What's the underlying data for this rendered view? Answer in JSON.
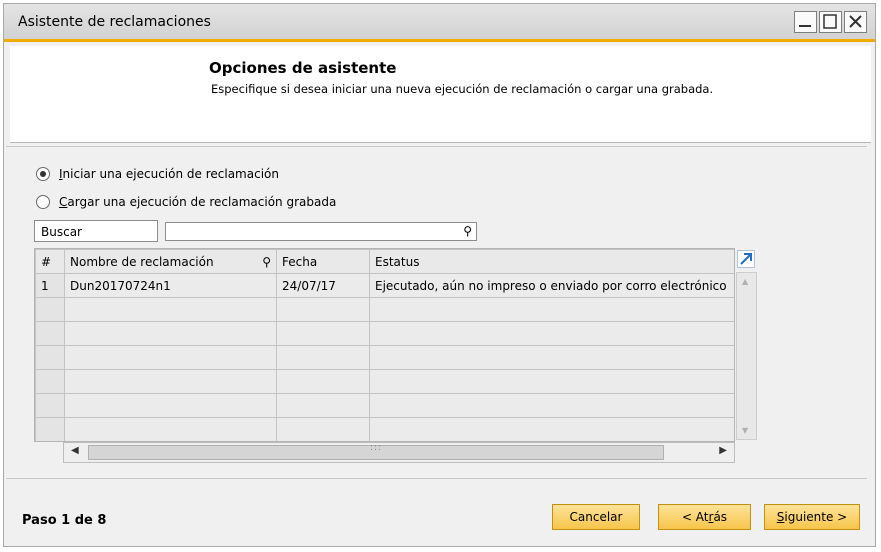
{
  "window": {
    "title": "Asistente de reclamaciones"
  },
  "header": {
    "title": "Opciones de asistente",
    "subtitle": "Especifique si desea iniciar una nueva ejecución de reclamación o cargar una grabada."
  },
  "options": {
    "selected": "new_run",
    "new_run": {
      "label_accel": "I",
      "label_rest": "niciar una ejecución de reclamación"
    },
    "load_saved": {
      "label_accel": "C",
      "label_rest": "argar una ejecución de reclamación grabada"
    }
  },
  "search": {
    "label": "Buscar",
    "value": ""
  },
  "table": {
    "columns": [
      "#",
      "Nombre de reclamación",
      "Fecha",
      "Estatus"
    ],
    "rows": [
      [
        "1",
        "Dun20170724n1",
        "24/07/17",
        "Ejecutado, aún no impreso o enviado por corro electrónico"
      ],
      [
        "",
        "",
        "",
        ""
      ],
      [
        "",
        "",
        "",
        ""
      ],
      [
        "",
        "",
        "",
        ""
      ],
      [
        "",
        "",
        "",
        ""
      ],
      [
        "",
        "",
        "",
        ""
      ],
      [
        "",
        "",
        "",
        ""
      ]
    ]
  },
  "footer": {
    "step": "Paso 1 de 8",
    "cancel": "Cancelar",
    "back_prefix": "< At",
    "back_accel": "r",
    "back_suffix": "ás",
    "next_accel": "S",
    "next_rest": "iguiente >"
  },
  "colors": {
    "accent": "#f0ab00",
    "button_fill": "#f7c54a",
    "window_bg": "#f0f0f0"
  },
  "icons": [
    "minimize-icon",
    "maximize-icon",
    "close-icon",
    "key-icon",
    "expand-icon",
    "arrow-left-icon",
    "arrow-right-icon",
    "arrow-up-icon",
    "arrow-down-icon"
  ]
}
